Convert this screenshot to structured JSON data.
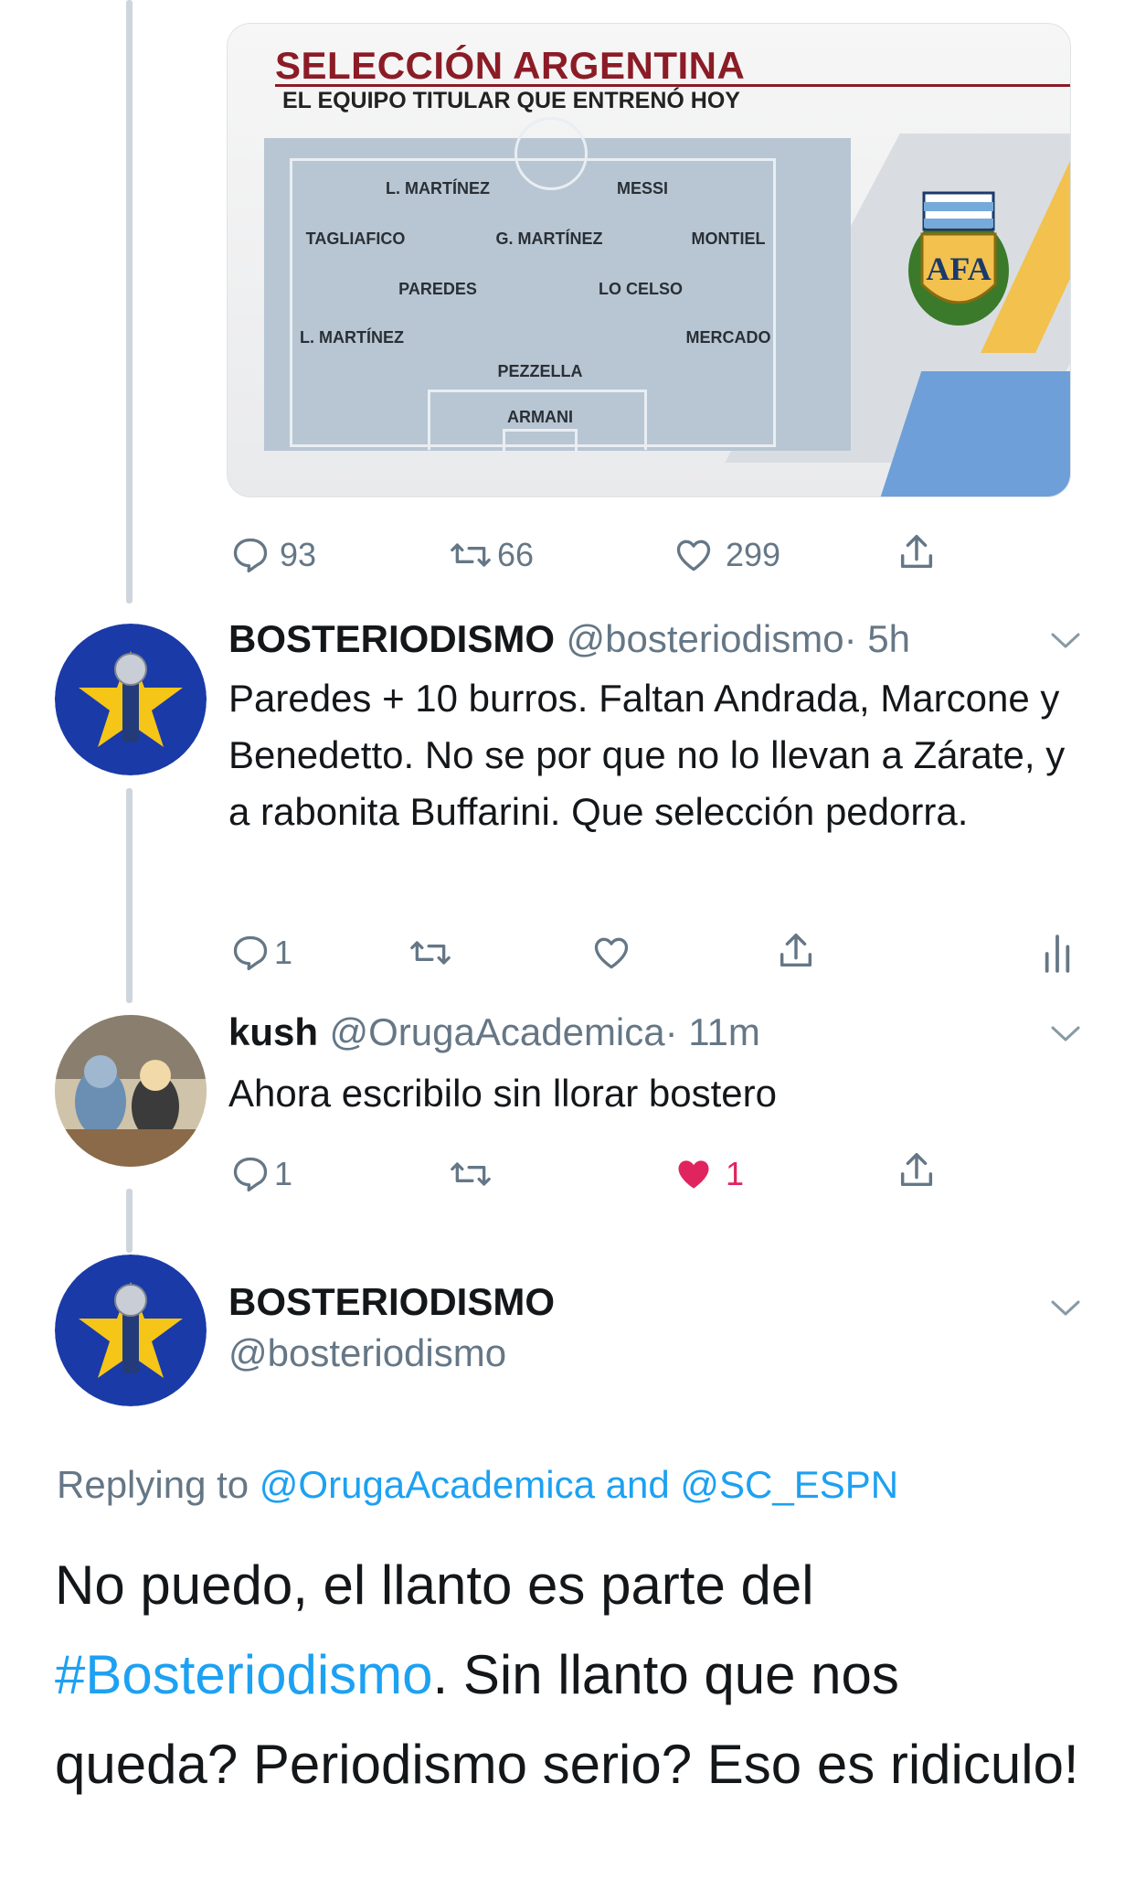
{
  "card": {
    "title": "SELECCIÓN ARGENTINA",
    "subtitle": "EL EQUIPO TITULAR QUE ENTRENÓ HOY",
    "players": [
      "L. MARTÍNEZ",
      "MESSI",
      "TAGLIAFICO",
      "G. MARTÍNEZ",
      "MONTIEL",
      "PAREDES",
      "LO CELSO",
      "L. MARTÍNEZ",
      "MERCADO",
      "PEZZELLA",
      "ARMANI"
    ],
    "crest_text": "AFA"
  },
  "tweet1_actions": {
    "replies": "93",
    "retweets": "66",
    "likes": "299"
  },
  "tweet2": {
    "name": "BOSTERIODISMO",
    "handle": "@bosteriodismo",
    "time": "· 5h",
    "text": "Paredes + 10 burros. Faltan Andrada, Marcone y Benedetto. No se por que no lo llevan a Zárate, y a rabonita Buffarini. Que selección pedorra.",
    "replies": "1"
  },
  "tweet3": {
    "name": "kush",
    "handle": "@OrugaAcademica",
    "time": "· 11m",
    "text": "Ahora escribilo sin llorar bostero",
    "replies": "1",
    "likes": "1"
  },
  "tweet4": {
    "name": "BOSTERIODISMO",
    "handle": "@bosteriodismo",
    "replying_prefix": "Replying to",
    "replying_user1": "@OrugaAcademica",
    "replying_and": "and",
    "replying_user2": "@SC_ESPN",
    "text_part1": "No puedo, el llanto es parte del",
    "hashtag": "#Bosteriodismo",
    "text_part2": ". Sin llanto que nos queda? Periodismo serio? Eso es ridiculo!"
  },
  "colors": {
    "accent": "#1da1f2",
    "like": "#e0245e",
    "muted": "#657786",
    "avatar_blue": "#1a3aa8",
    "star": "#f5c518"
  }
}
